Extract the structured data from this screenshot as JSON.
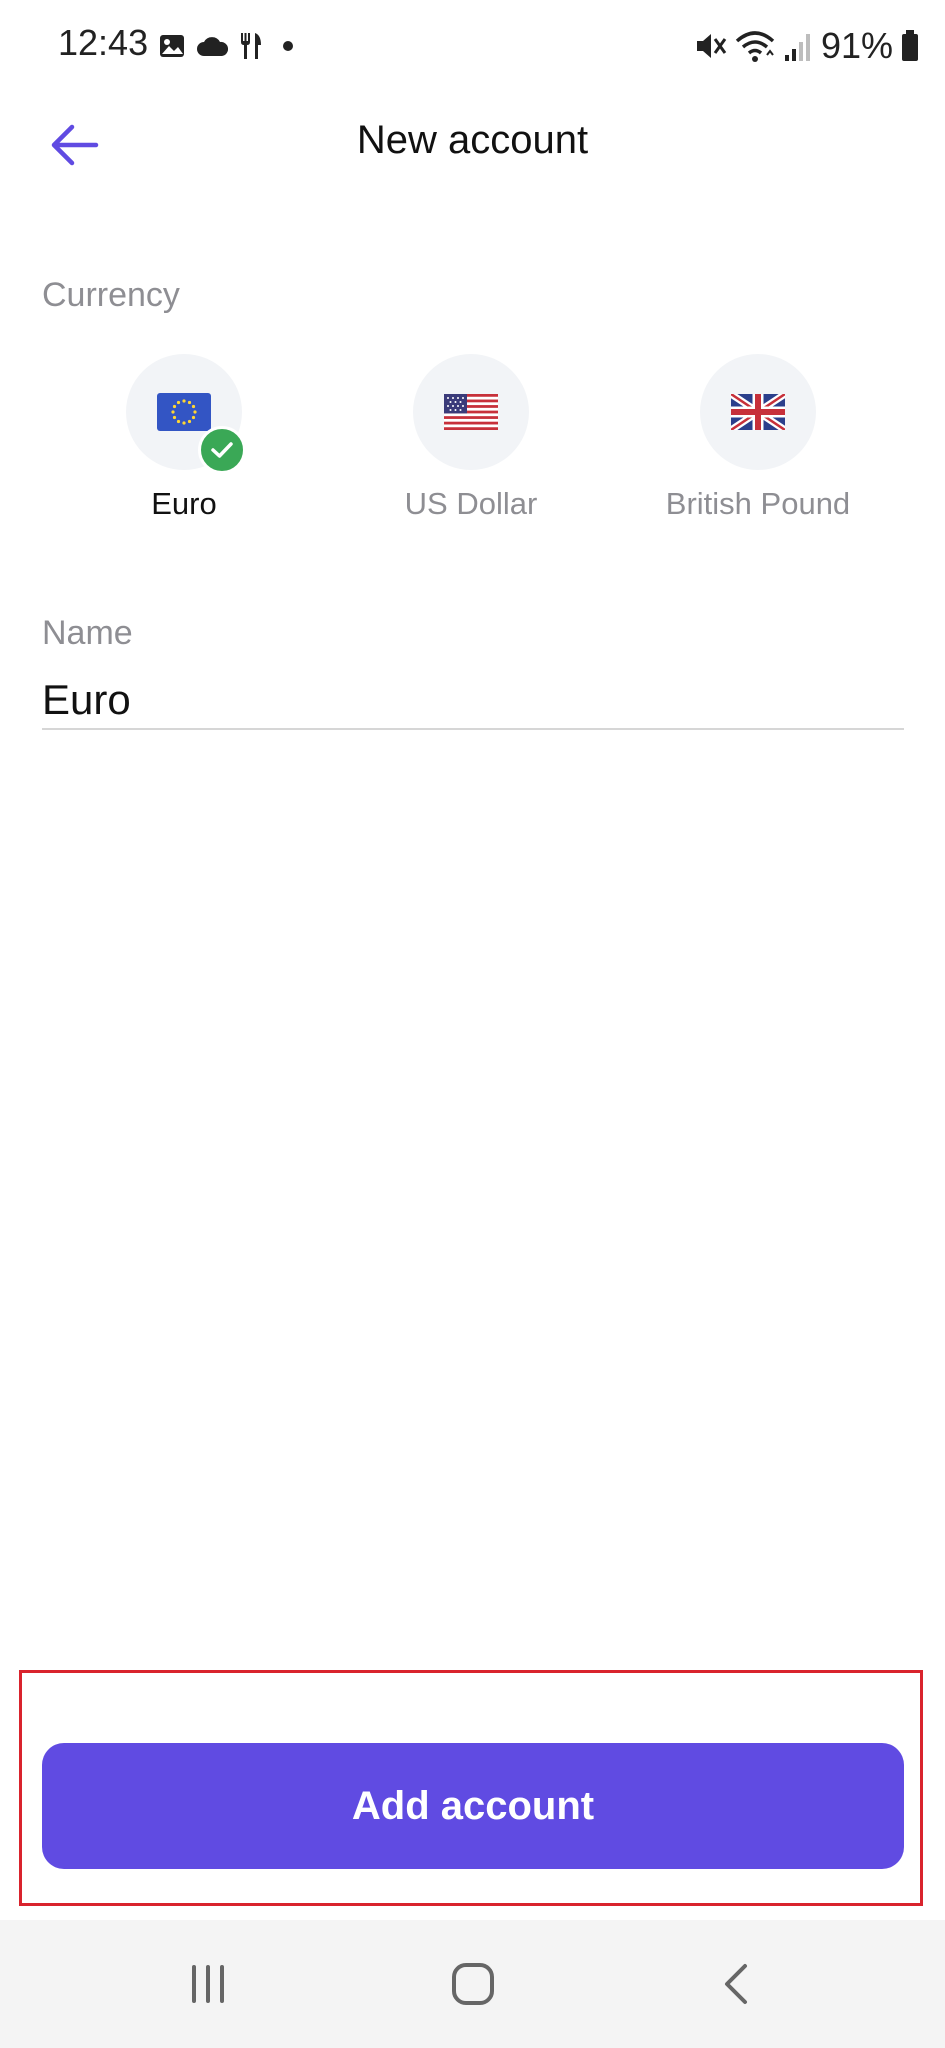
{
  "status_bar": {
    "time": "12:43",
    "battery": "91%",
    "icons_left": [
      "gallery-icon",
      "cloud-icon",
      "restaurant-icon",
      "dot-icon"
    ],
    "icons_right": [
      "mute-icon",
      "wifi-icon",
      "signal-icon",
      "battery-icon"
    ]
  },
  "app_bar": {
    "title": "New account",
    "back_icon": "arrow-left-icon"
  },
  "currency": {
    "label": "Currency",
    "options": [
      {
        "label": "Euro",
        "icon": "eu-flag-icon",
        "selected": true
      },
      {
        "label": "US Dollar",
        "icon": "us-flag-icon",
        "selected": false
      },
      {
        "label": "British Pound",
        "icon": "uk-flag-icon",
        "selected": false
      }
    ]
  },
  "name_field": {
    "label": "Name",
    "value": "Euro"
  },
  "primary_action": {
    "label": "Add account"
  },
  "navigation_bar": {
    "buttons": [
      "recents-icon",
      "home-icon",
      "back-icon"
    ]
  },
  "colors": {
    "accent": "#604be2",
    "check_green": "#3aa856",
    "highlight_red": "#d9232d",
    "muted_text": "#8e8e93"
  }
}
